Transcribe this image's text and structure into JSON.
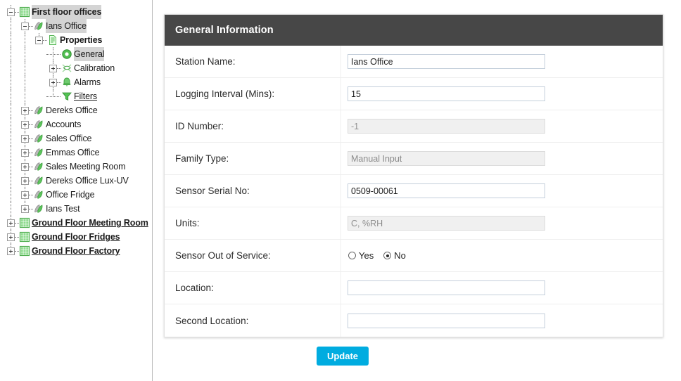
{
  "sidebar": {
    "tree": [
      {
        "label": "First floor offices",
        "depth": 0,
        "icon": "grid-icon",
        "toggle": "minus",
        "selected": true,
        "underline": false,
        "bold": true
      },
      {
        "label": "Ians Office",
        "depth": 1,
        "icon": "sensor-icon",
        "toggle": "minus",
        "selected": true,
        "underline": false,
        "bold": false
      },
      {
        "label": "Properties",
        "depth": 2,
        "icon": "document-icon",
        "toggle": "minus",
        "selected": false,
        "underline": false,
        "bold": true
      },
      {
        "label": "General",
        "depth": 3,
        "icon": "circle-icon",
        "toggle": "none",
        "selected": true,
        "underline": false,
        "bold": false
      },
      {
        "label": "Calibration",
        "depth": 3,
        "icon": "calibration-icon",
        "toggle": "plus",
        "selected": false,
        "underline": false,
        "bold": false
      },
      {
        "label": "Alarms",
        "depth": 3,
        "icon": "bell-icon",
        "toggle": "plus",
        "selected": false,
        "underline": false,
        "bold": false
      },
      {
        "label": "Filters",
        "depth": 3,
        "icon": "funnel-icon",
        "toggle": "none",
        "selected": false,
        "underline": true,
        "bold": false
      },
      {
        "label": "Dereks Office",
        "depth": 1,
        "icon": "sensor-icon",
        "toggle": "plus",
        "selected": false,
        "underline": false,
        "bold": false
      },
      {
        "label": "Accounts",
        "depth": 1,
        "icon": "sensor-icon",
        "toggle": "plus",
        "selected": false,
        "underline": false,
        "bold": false
      },
      {
        "label": "Sales Office",
        "depth": 1,
        "icon": "sensor-icon",
        "toggle": "plus",
        "selected": false,
        "underline": false,
        "bold": false
      },
      {
        "label": "Emmas Office",
        "depth": 1,
        "icon": "sensor-icon",
        "toggle": "plus",
        "selected": false,
        "underline": false,
        "bold": false
      },
      {
        "label": "Sales Meeting Room",
        "depth": 1,
        "icon": "sensor-icon",
        "toggle": "plus",
        "selected": false,
        "underline": false,
        "bold": false
      },
      {
        "label": "Dereks Office Lux-UV",
        "depth": 1,
        "icon": "sensor-icon",
        "toggle": "plus",
        "selected": false,
        "underline": false,
        "bold": false
      },
      {
        "label": "Office Fridge",
        "depth": 1,
        "icon": "sensor-icon",
        "toggle": "plus",
        "selected": false,
        "underline": false,
        "bold": false
      },
      {
        "label": "Ians Test",
        "depth": 1,
        "icon": "sensor-icon",
        "toggle": "plus",
        "selected": false,
        "underline": false,
        "bold": false
      },
      {
        "label": "Ground Floor Meeting Room",
        "depth": 0,
        "icon": "grid-icon",
        "toggle": "plus",
        "selected": false,
        "underline": true,
        "bold": true
      },
      {
        "label": "Ground Floor Fridges",
        "depth": 0,
        "icon": "grid-icon",
        "toggle": "plus",
        "selected": false,
        "underline": true,
        "bold": true
      },
      {
        "label": "Ground Floor Factory",
        "depth": 0,
        "icon": "grid-icon",
        "toggle": "plus",
        "selected": false,
        "underline": true,
        "bold": true
      }
    ]
  },
  "panel": {
    "title": "General Information",
    "header_bg": "#474747",
    "rows": [
      {
        "label": "Station Name:",
        "type": "text",
        "value": "Ians Office",
        "placeholder": "",
        "readonly": false,
        "name": "station-name"
      },
      {
        "label": "Logging Interval (Mins):",
        "type": "text",
        "value": "15",
        "placeholder": "",
        "readonly": false,
        "name": "logging-interval"
      },
      {
        "label": "ID Number:",
        "type": "text",
        "value": "-1",
        "placeholder": "",
        "readonly": true,
        "name": "id-number"
      },
      {
        "label": "Family Type:",
        "type": "text",
        "value": "Manual Input",
        "placeholder": "",
        "readonly": true,
        "name": "family-type"
      },
      {
        "label": "Sensor Serial No:",
        "type": "text",
        "value": "0509-00061",
        "placeholder": "",
        "readonly": false,
        "name": "sensor-serial-no"
      },
      {
        "label": "Units:",
        "type": "text",
        "value": "C, %RH",
        "placeholder": "",
        "readonly": true,
        "name": "units"
      },
      {
        "label": "Sensor Out of Service:",
        "type": "radio",
        "options": [
          "Yes",
          "No"
        ],
        "selected": "No",
        "name": "sensor-out-of-service"
      },
      {
        "label": "Location:",
        "type": "text",
        "value": "",
        "placeholder": "",
        "readonly": false,
        "name": "location"
      },
      {
        "label": "Second Location:",
        "type": "text",
        "value": "",
        "placeholder": "",
        "readonly": false,
        "name": "second-location"
      }
    ],
    "update_label": "Update",
    "update_color": "#00ace0"
  }
}
